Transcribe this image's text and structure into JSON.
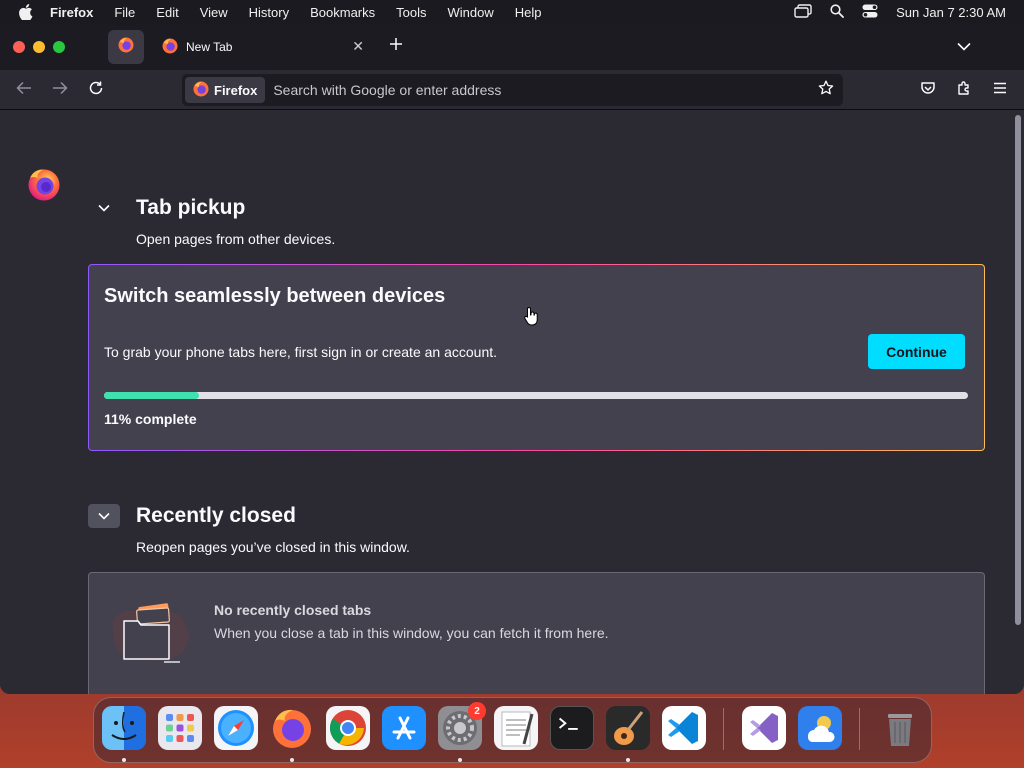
{
  "menubar": {
    "app_name": "Firefox",
    "items": [
      "File",
      "Edit",
      "View",
      "History",
      "Bookmarks",
      "Tools",
      "Window",
      "Help"
    ],
    "clock": "Sun Jan 7  2:30 AM"
  },
  "tabs": {
    "active_tab_title": "New Tab"
  },
  "urlbar": {
    "identity_label": "Firefox",
    "placeholder": "Search with Google or enter address"
  },
  "tab_pickup": {
    "title": "Tab pickup",
    "subtitle": "Open pages from other devices.",
    "card_title": "Switch seamlessly between devices",
    "card_text": "To grab your phone tabs here, first sign in or create an account.",
    "continue_label": "Continue",
    "progress_percent": 11,
    "progress_label": "11% complete"
  },
  "recently_closed": {
    "title": "Recently closed",
    "subtitle": "Reopen pages you’ve closed in this window.",
    "empty_title": "No recently closed tabs",
    "empty_text": "When you close a tab in this window, you can fetch it from here."
  },
  "dock": {
    "apps": [
      "finder",
      "launchpad",
      "safari",
      "firefox",
      "chrome",
      "app-store",
      "system-settings",
      "textedit",
      "terminal",
      "garageband",
      "vscode",
      "visual-studio",
      "weather",
      "trash"
    ],
    "system_settings_badge": "2"
  },
  "colors": {
    "accent": "#00ddff",
    "progress": "#3fe1b0",
    "page_bg": "#2b2a33",
    "card_bg": "#42414d"
  }
}
